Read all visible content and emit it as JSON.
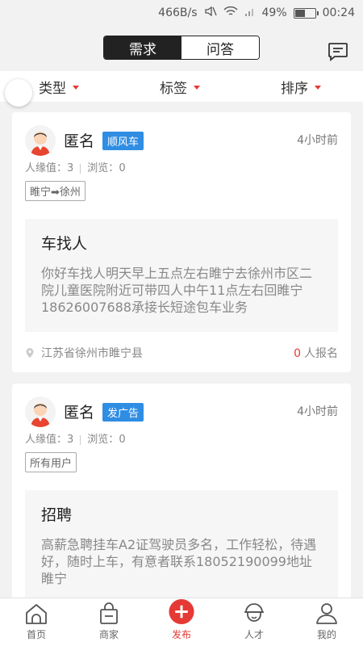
{
  "status_bar": {
    "speed": "466B/s",
    "battery": "49%",
    "time": "00:24",
    "battery_level": 0.49
  },
  "header": {
    "segments": [
      {
        "label": "需求",
        "active": true
      },
      {
        "label": "问答",
        "active": false
      }
    ],
    "message_icon": "message-icon"
  },
  "filters": [
    {
      "label": "类型"
    },
    {
      "label": "标签"
    },
    {
      "label": "排序"
    }
  ],
  "posts": [
    {
      "name": "匿名",
      "badge": "顺风车",
      "time": "4小时前",
      "popularity_label": "人缘值：",
      "popularity": "3",
      "views_label": "浏览：",
      "views": "0",
      "tag": "睢宁➡徐州",
      "title": "车找人",
      "body": "你好车找人明天早上五点左右睢宁去徐州市区二院儿童医院附近可带四人中午11点左右回睢宁18626007688承接长短途包车业务",
      "location": "江苏省徐州市睢宁县",
      "signup_count": "0",
      "signup_label": "人报名"
    },
    {
      "name": "匿名",
      "badge": "发广告",
      "time": "4小时前",
      "popularity_label": "人缘值：",
      "popularity": "3",
      "views_label": "浏览：",
      "views": "0",
      "tag": "所有用户",
      "title": "招聘",
      "body": "高薪急聘挂车A2证驾驶员多名，工作轻松，待遇好，随时上车，有意者联系18052190099地址睢宁"
    }
  ],
  "nav": [
    {
      "label": "首页",
      "icon": "home-icon"
    },
    {
      "label": "商家",
      "icon": "shopping-bag-icon"
    },
    {
      "label": "发布",
      "icon": "plus-circle-icon"
    },
    {
      "label": "人才",
      "icon": "worker-helmet-icon"
    },
    {
      "label": "我的",
      "icon": "user-icon"
    }
  ],
  "colors": {
    "accent": "#e53935",
    "badge": "#2f8de4",
    "segment_active": "#222222"
  }
}
